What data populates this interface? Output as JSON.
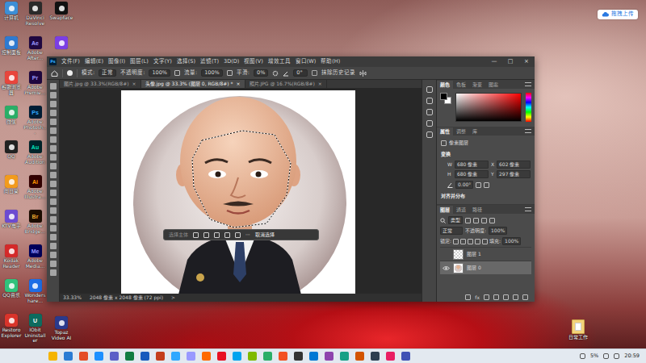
{
  "desktop": {
    "columns": [
      [
        {
          "label": "计算机",
          "color": "#3d8fd6"
        },
        {
          "label": "控制面板",
          "color": "#2f7ad1"
        },
        {
          "label": "谷歌浏览器",
          "color": "#e8453c"
        },
        {
          "label": "微信",
          "color": "#2aae67"
        },
        {
          "label": "QQ",
          "color": "#222222"
        },
        {
          "label": "向日葵",
          "color": "#f29b1d"
        },
        {
          "label": "KTV电子",
          "color": "#6c4bd1"
        },
        {
          "label": "Kodak Reader",
          "color": "#d42a2a"
        },
        {
          "label": "QQ音乐",
          "color": "#31c27c"
        },
        {
          "label": "Restoro Explorer",
          "color": "#d9342b"
        }
      ],
      [
        {
          "label": "DaVinci Resolve",
          "color": "#2a2a2a"
        },
        {
          "label": "Adobe After...",
          "glyph": "Ae",
          "glyph_color": "#9999ff",
          "color": "#1f0740"
        },
        {
          "label": "Adobe Premie...",
          "glyph": "Pr",
          "glyph_color": "#9999ff",
          "color": "#1f0740"
        },
        {
          "label": "Adobe Photosh...",
          "glyph": "Ps",
          "glyph_color": "#31a8ff",
          "color": "#001e36"
        },
        {
          "label": "Adobe Audition",
          "glyph": "Au",
          "glyph_color": "#00e4bb",
          "color": "#00252b"
        },
        {
          "label": "Adobe Illustra...",
          "glyph": "Ai",
          "glyph_color": "#ff9a00",
          "color": "#330000"
        },
        {
          "label": "Adobe Bridge...",
          "glyph": "Br",
          "glyph_color": "#e8a530",
          "color": "#1c0d00"
        },
        {
          "label": "Adobe Media...",
          "glyph": "Me",
          "glyph_color": "#9999ff",
          "color": "#00005b"
        },
        {
          "label": "Wondershare...",
          "color": "#1e6ee6"
        },
        {
          "label": "IObit Uninstaller",
          "glyph": "U",
          "glyph_color": "#ffffff",
          "color": "#0d6b5e"
        }
      ],
      [
        {
          "label": "Swapface",
          "color": "#111111"
        },
        {
          "color": "#7b3fe4"
        }
      ],
      [
        {
          "label": "Topaz Video AI",
          "color": "#2b3a8c"
        }
      ]
    ],
    "upload": "拖拽上传",
    "folder": "日常工作"
  },
  "photoshop": {
    "logo": "Ps",
    "menu": [
      "文件(F)",
      "编辑(E)",
      "图像(I)",
      "图层(L)",
      "文字(Y)",
      "选择(S)",
      "滤镜(T)",
      "3D(D)",
      "视图(V)",
      "增效工具",
      "窗口(W)",
      "帮助(H)"
    ],
    "window_controls": [
      "—",
      "□",
      "×"
    ],
    "options": {
      "mode_label": "模式:",
      "mode": "正常",
      "opacity_label": "不透明度:",
      "opacity": "100%",
      "flow_label": "流量:",
      "flow": "100%",
      "smoothing_label": "平滑:",
      "smoothing": "0%",
      "angle": "0°",
      "erase_history": {
        "label": "抹除历史记录",
        "checked": false
      }
    },
    "tabs": [
      {
        "label": "图片.jpg @ 33.3%(RGB/8#)",
        "close": "×",
        "selected": false
      },
      {
        "label": "头像.jpg @ 33.3% (图层 0, RGB/8#) *",
        "close": "×",
        "selected": true
      },
      {
        "label": "照片.JPG @ 16.7%(RGB/8#)",
        "close": "×",
        "selected": false
      }
    ],
    "context_bar": {
      "subject": "选择主体",
      "more": "···",
      "deselect": "取消选择"
    },
    "status": {
      "zoom": "33.33%",
      "size": "2048 像素 x 2048 像素 (72 ppi)",
      "arrow": ">"
    },
    "color_panel": {
      "tabs": [
        {
          "label": "颜色",
          "selected": true
        },
        {
          "label": "色板",
          "selected": false
        },
        {
          "label": "渐变",
          "selected": false
        },
        {
          "label": "图案",
          "selected": false
        }
      ],
      "swatches": [
        {
          "color": "#000000"
        },
        {
          "color": "#ffffff"
        }
      ],
      "hue": "#ff0000"
    },
    "properties": {
      "tabs": [
        {
          "label": "属性",
          "selected": true
        },
        {
          "label": "调整",
          "selected": false
        },
        {
          "label": "库",
          "selected": false
        }
      ],
      "kind": "像素图层",
      "transform_title": "变换",
      "fields": [
        {
          "label": "W",
          "value": "680 像素"
        },
        {
          "label": "X",
          "value": "602 像素"
        },
        {
          "label": "H",
          "value": "680 像素"
        },
        {
          "label": "Y",
          "value": "297 像素"
        }
      ],
      "angle": "0.00°",
      "align_title": "对齐并分布"
    },
    "layers_panel": {
      "tabs": [
        {
          "label": "图层",
          "selected": true
        },
        {
          "label": "通道",
          "selected": false
        },
        {
          "label": "路径",
          "selected": false
        }
      ],
      "filter": "类型",
      "blend": "正常",
      "opacity_label": "不透明度:",
      "opacity": "100%",
      "lock_label": "锁定:",
      "fill_label": "填充:",
      "fill": "100%",
      "layers": [
        {
          "name": "图层 1",
          "visible": false,
          "selected": false,
          "kind": "empty"
        },
        {
          "name": "图层 0",
          "visible": true,
          "selected": true,
          "kind": "photo"
        }
      ],
      "footer_fx": "fx"
    }
  },
  "taskbar": {
    "apps": [
      {
        "color": "#f5b400"
      },
      {
        "color": "#2b7cd3"
      },
      {
        "color": "#e44d26"
      },
      {
        "color": "#1e90ff"
      },
      {
        "color": "#5b5fc7"
      },
      {
        "color": "#107c41"
      },
      {
        "color": "#185abd"
      },
      {
        "color": "#c43e1c"
      },
      {
        "color": "#31a8ff"
      },
      {
        "color": "#9999ff"
      },
      {
        "color": "#ff6a00"
      },
      {
        "color": "#e81123"
      },
      {
        "color": "#00a4ef"
      },
      {
        "color": "#7fba00"
      },
      {
        "color": "#2aae67"
      },
      {
        "color": "#f25022"
      },
      {
        "color": "#333333"
      },
      {
        "color": "#0078d4"
      },
      {
        "color": "#8e44ad"
      },
      {
        "color": "#16a085"
      },
      {
        "color": "#d35400"
      },
      {
        "color": "#2c3e50"
      },
      {
        "color": "#e91e63"
      },
      {
        "color": "#3f51b5"
      }
    ],
    "battery": "5%",
    "time": "20:59"
  }
}
